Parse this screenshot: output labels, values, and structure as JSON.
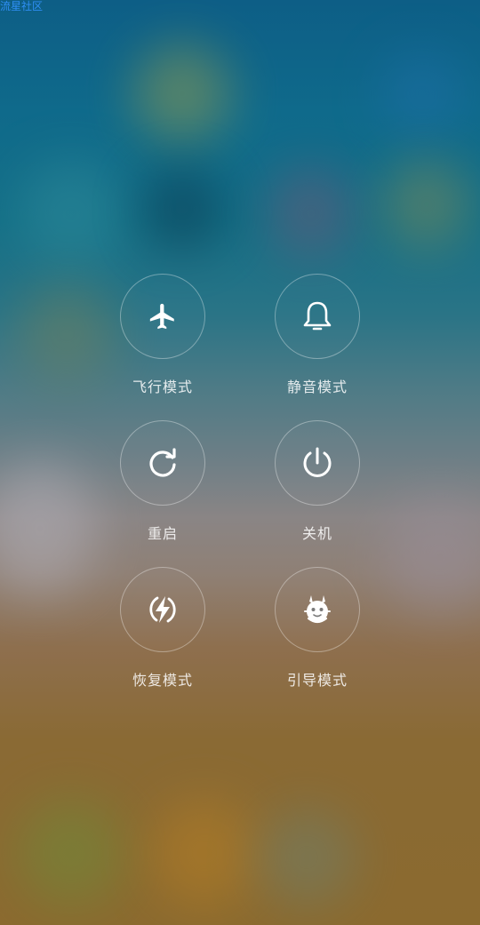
{
  "watermark": "流星社区",
  "menu": {
    "items": [
      {
        "label": "飞行模式",
        "icon": "airplane-icon"
      },
      {
        "label": "静音模式",
        "icon": "bell-icon"
      },
      {
        "label": "重启",
        "icon": "restart-icon"
      },
      {
        "label": "关机",
        "icon": "power-icon"
      },
      {
        "label": "恢复模式",
        "icon": "lightning-icon"
      },
      {
        "label": "引导模式",
        "icon": "mitu-bunny-icon"
      }
    ]
  },
  "colors": {
    "watermark": "#2f8ff5",
    "icon": "#ffffff",
    "circle_border": "rgba(255,255,255,0.35)"
  }
}
